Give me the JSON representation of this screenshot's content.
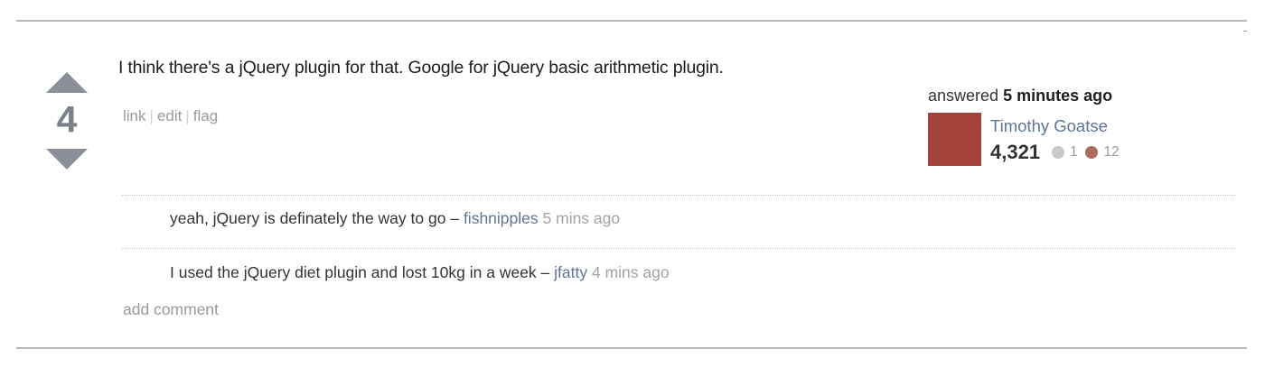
{
  "answer": {
    "votes": "4",
    "text": "I think there's a jQuery plugin for that. Google for jQuery basic arithmetic plugin.",
    "menu": {
      "link": "link",
      "edit": "edit",
      "flag": "flag",
      "separator": "|"
    }
  },
  "user_card": {
    "action": "answered",
    "time": "5 minutes ago",
    "name": "Timothy Goatse",
    "reputation": "4,321",
    "badges": {
      "silver": "1",
      "bronze": "12"
    },
    "avatar_color": "#a4423a"
  },
  "comments": [
    {
      "text": "yeah, jQuery is definately the way to go",
      "dash": "–",
      "user": "fishnipples",
      "ago": "5 mins ago"
    },
    {
      "text": "I used the jQuery diet plugin and lost 10kg in a week",
      "dash": "–",
      "user": "jfatty",
      "ago": "4 mins ago"
    }
  ],
  "add_comment": "add comment",
  "colors": {
    "link": "#5d7597",
    "muted": "#9a9a9a",
    "vote_arrow": "#8a8f99"
  }
}
